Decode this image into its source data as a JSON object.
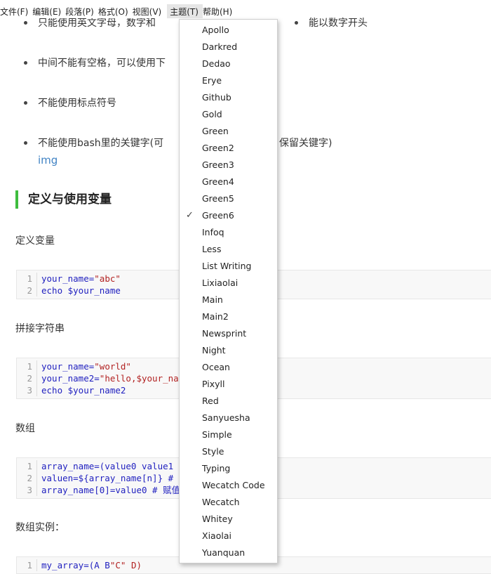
{
  "menubar": [
    "文件(F)",
    "编辑(E)",
    "段落(P)",
    "格式(O)",
    "视图(V)",
    "主题(T)",
    "帮助(H)"
  ],
  "bullets": [
    "只能使用英文字母，数字和",
    "中间不能有空格，可以使用下",
    "不能使用标点符号",
    "不能使用bash里的关键字(可"
  ],
  "bullet_tails": [
    "能以数字开头",
    "保留关键字)"
  ],
  "img_link": "img",
  "heading": "定义与使用变量",
  "paragraphs": [
    "定义变量",
    "拼接字符串",
    "数组",
    "数组实例："
  ],
  "code_blocks": [
    [
      {
        "n": "1",
        "a": "your_name=",
        "s": "\"abc\""
      },
      {
        "n": "2",
        "a": "echo $your_name",
        "s": ""
      }
    ],
    [
      {
        "n": "1",
        "a": "your_name=",
        "s": "\"world\""
      },
      {
        "n": "2",
        "a": "your_name2=",
        "s": "\"hello,$your_na"
      },
      {
        "n": "3",
        "a": "echo $your_name2",
        "s": ""
      }
    ],
    [
      {
        "n": "1",
        "a": "array_name=(value0 value1",
        "s": ""
      },
      {
        "n": "2",
        "a": "valuen=${array_name[n]} #",
        "s": ""
      },
      {
        "n": "3",
        "a": "array_name[0]=value0 # 赋值",
        "s": ""
      }
    ],
    [
      {
        "n": "1",
        "a": "my_array=(A B ",
        "s": "\"C\" D)"
      }
    ]
  ],
  "theme_menu": {
    "selected": "Green6",
    "items": [
      "Apollo",
      "Darkred",
      "Dedao",
      "Erye",
      "Github",
      "Gold",
      "Green",
      "Green2",
      "Green3",
      "Green4",
      "Green5",
      "Green6",
      "Infoq",
      "Less",
      "List Writing",
      "Lixiaolai",
      "Main",
      "Main2",
      "Newsprint",
      "Night",
      "Ocean",
      "Pixyll",
      "Red",
      "Sanyuesha",
      "Simple",
      "Style",
      "Typing",
      "Wecatch Code",
      "Wecatch",
      "Whitey",
      "Xiaolai",
      "Yuanquan"
    ]
  }
}
